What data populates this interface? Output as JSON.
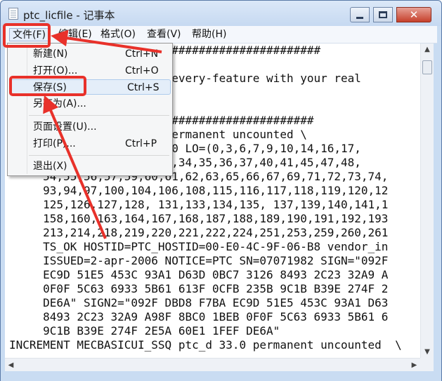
{
  "window": {
    "title": "ptc_licfile - 记事本",
    "icon": "notepad-icon",
    "controls": {
      "minimize": "minimize-icon",
      "maximize": "maximize-icon",
      "close": "close-icon"
    },
    "close_glyph": "✕"
  },
  "menubar": {
    "file": "文件(F)",
    "edit": "编辑(E)",
    "format": "格式(O)",
    "view": "查看(V)",
    "help": "帮助(H)"
  },
  "file_menu": {
    "items": [
      {
        "label": "新建(N)",
        "shortcut": "Ctrl+N"
      },
      {
        "label": "打开(O)...",
        "shortcut": "Ctrl+O"
      },
      {
        "label": "保存(S)",
        "shortcut": "Ctrl+S"
      },
      {
        "label": "另存为(A)...",
        "shortcut": ""
      },
      {
        "label": "页面设置(U)...",
        "shortcut": ""
      },
      {
        "label": "打印(P)...",
        "shortcut": "Ctrl+P"
      },
      {
        "label": "退出(X)",
        "shortcut": ""
      }
    ]
  },
  "editor": {
    "lines": [
      "##############################################",
      "",
      "                6-B8 in every-feature with your real",
      "",
      "",
      "                   ##########################",
      "                d 33.0 permanent uncounted \\",
      "                VSVER=2.0 LO=(0,3,6,7,9,10,14,16,17,",
      "                30,31,32,34,35,36,37,40,41,45,47,48,",
      "     54,55,56,57,59,60,61,62,63,65,66,67,69,71,72,73,74,",
      "     93,94,97,100,104,106,108,115,116,117,118,119,120,12",
      "     125,126,127,128, 131,133,134,135, 137,139,140,141,1",
      "     158,160,163,164,167,168,187,188,189,190,191,192,193",
      "     213,214,218,219,220,221,222,224,251,253,259,260,261",
      "     TS_OK HOSTID=PTC_HOSTID=00-E0-4C-9F-06-B8 vendor_in",
      "     ISSUED=2-apr-2006 NOTICE=PTC SN=07071982 SIGN=\"092F",
      "     EC9D 51E5 453C 93A1 D63D 0BC7 3126 8493 2C23 32A9 A",
      "     0F0F 5C63 6933 5B61 613F 0CFB 235B 9C1B B39E 274F 2",
      "     DE6A\" SIGN2=\"092F DBD8 F7BA EC9D 51E5 453C 93A1 D63",
      "     8493 2C23 32A9 A98F 8BC0 1BEB 0F0F 5C63 6933 5B61 6",
      "     9C1B B39E 274F 2E5A 60E1 1FEF DE6A\"",
      "INCREMENT MECBASICUI_SSQ ptc_d 33.0 permanent uncounted  \\"
    ]
  },
  "scrollbars": {
    "up": "▲",
    "down": "▼",
    "left": "◀",
    "right": "▶"
  },
  "annotation_color": "#e8312a"
}
